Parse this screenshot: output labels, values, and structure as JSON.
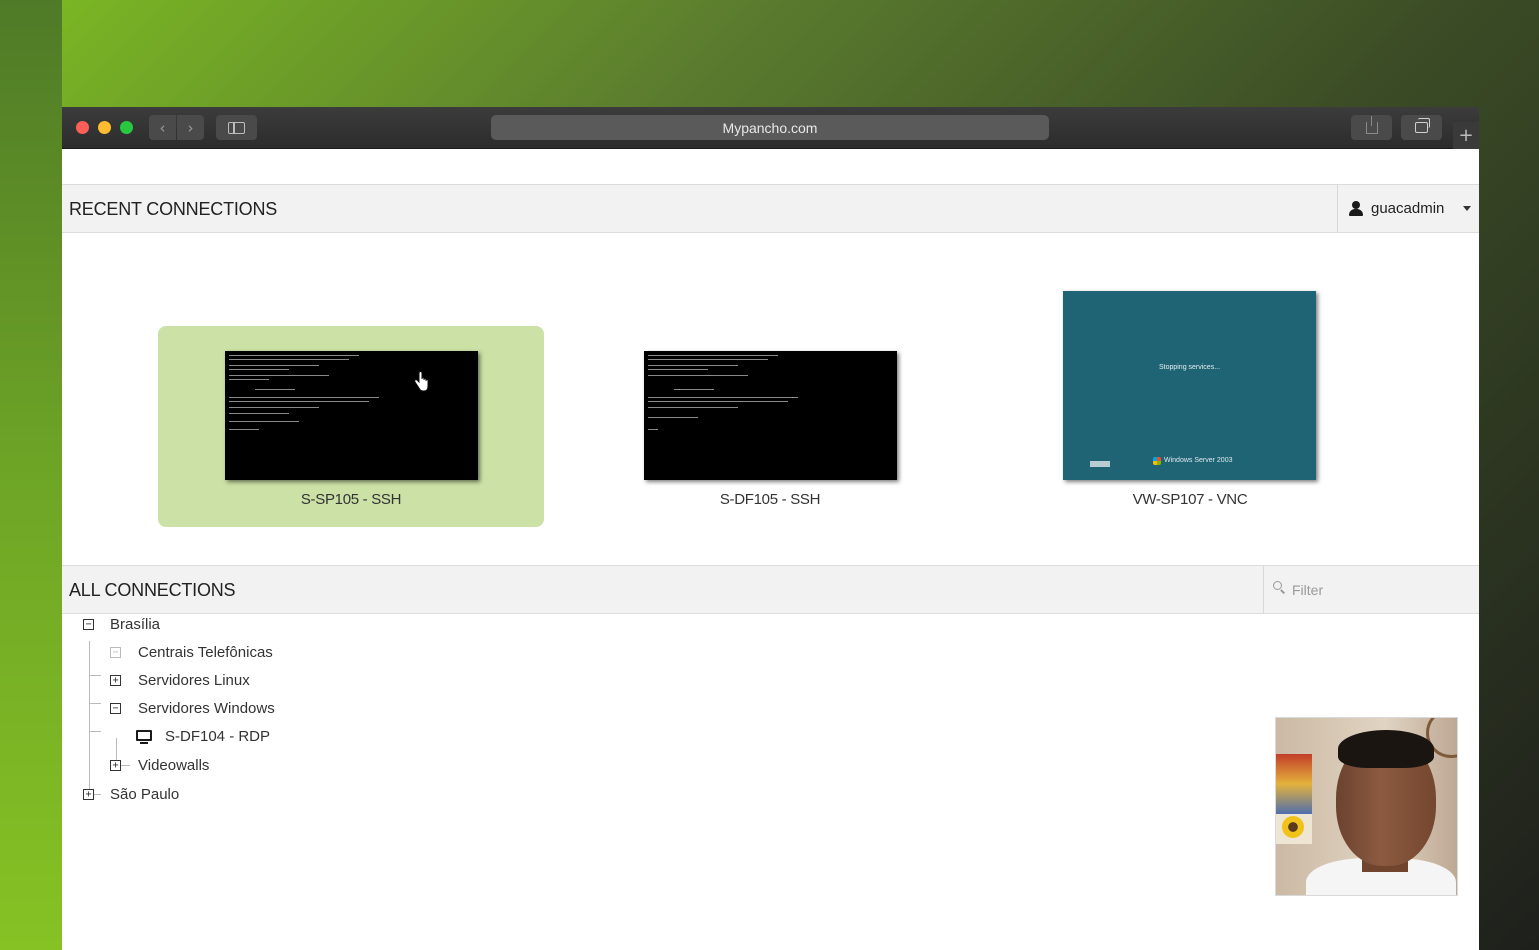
{
  "browser": {
    "url": "Mypancho.com",
    "back_icon": "chevron-left-icon",
    "forward_icon": "chevron-right-icon",
    "new_tab_label": "+"
  },
  "recent": {
    "title": "RECENT CONNECTIONS",
    "user": "guacadmin",
    "connections": [
      {
        "label": "S-SP105 - SSH",
        "active": true
      },
      {
        "label": "S-DF105 - SSH",
        "active": false
      },
      {
        "label": "VW-SP107 - VNC",
        "active": false
      }
    ],
    "vnc_status": "Stopping services...",
    "vnc_brand": "Windows Server 2003"
  },
  "all": {
    "title": "ALL CONNECTIONS",
    "filter_placeholder": "Filter",
    "tree": {
      "brasilia": "Brasília",
      "centrais": "Centrais Telefônicas",
      "linux": "Servidores Linux",
      "windows": "Servidores Windows",
      "rdp": "S-DF104 - RDP",
      "videowalls": "Videowalls",
      "saopaulo": "São Paulo"
    },
    "expand_glyph": "+",
    "collapse_glyph": "−"
  },
  "colors": {
    "active_card": "#cbe1a6",
    "vnc_bg": "#1f6475"
  }
}
